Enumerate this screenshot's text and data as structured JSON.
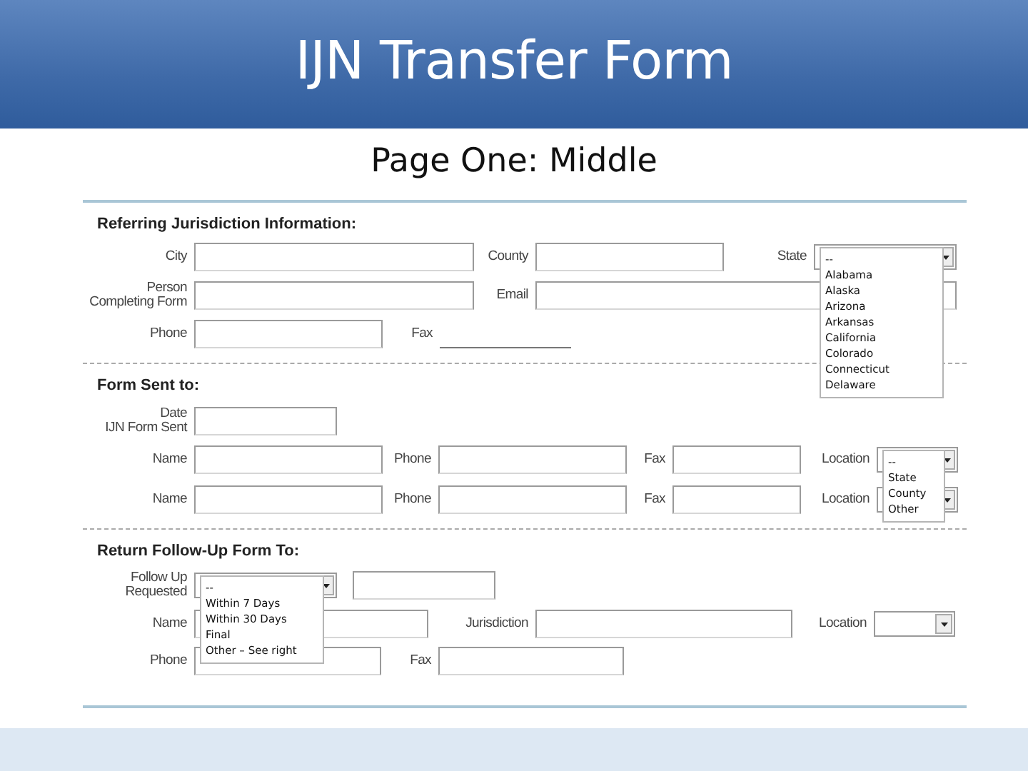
{
  "title": "IJN Transfer Form",
  "subtitle": "Page One: Middle",
  "sections": [
    {
      "heading": "Referring Jurisdiction Information:",
      "rows": [
        {
          "fields": [
            {
              "kind": "text",
              "label": "City"
            },
            {
              "kind": "text",
              "label": "County"
            },
            {
              "kind": "select",
              "label": "State",
              "expanded": true,
              "options": [
                "--",
                "Alabama",
                "Alaska",
                "Arizona",
                "Arkansas",
                "California",
                "Colorado",
                "Connecticut",
                "Delaware"
              ]
            }
          ]
        },
        {
          "fields": [
            {
              "kind": "text",
              "label": "Person\nCompleting Form"
            },
            {
              "kind": "text",
              "label": "Email"
            }
          ]
        },
        {
          "fields": [
            {
              "kind": "text",
              "label": "Phone"
            },
            {
              "kind": "line",
              "label": "Fax"
            }
          ]
        }
      ]
    },
    {
      "heading": "Form Sent to:",
      "rows": [
        {
          "fields": [
            {
              "kind": "text",
              "label": "Date\nIJN Form Sent"
            }
          ]
        },
        {
          "fields": [
            {
              "kind": "text",
              "label": "Name"
            },
            {
              "kind": "text",
              "label": "Phone"
            },
            {
              "kind": "text",
              "label": "Fax"
            },
            {
              "kind": "select",
              "label": "Location",
              "expanded": true,
              "options": [
                "--",
                "State",
                "County",
                "Other"
              ]
            }
          ]
        },
        {
          "fields": [
            {
              "kind": "text",
              "label": "Name"
            },
            {
              "kind": "text",
              "label": "Phone"
            },
            {
              "kind": "text",
              "label": "Fax"
            },
            {
              "kind": "select",
              "label": "Location",
              "expanded": false
            }
          ]
        }
      ]
    },
    {
      "heading": "Return Follow-Up Form To:",
      "rows": [
        {
          "fields": [
            {
              "kind": "select",
              "label": "Follow Up\nRequested",
              "expanded": true,
              "options": [
                "--",
                "Within 7 Days",
                "Within 30 Days",
                "Final",
                "Other – See right"
              ]
            },
            {
              "kind": "text"
            }
          ]
        },
        {
          "fields": [
            {
              "kind": "text",
              "label": "Name"
            },
            {
              "kind": "text",
              "label": "Jurisdiction"
            },
            {
              "kind": "select",
              "label": "Location",
              "expanded": false
            }
          ]
        },
        {
          "fields": [
            {
              "kind": "text",
              "label": "Phone"
            },
            {
              "kind": "text",
              "label": "Fax"
            }
          ]
        }
      ]
    }
  ]
}
